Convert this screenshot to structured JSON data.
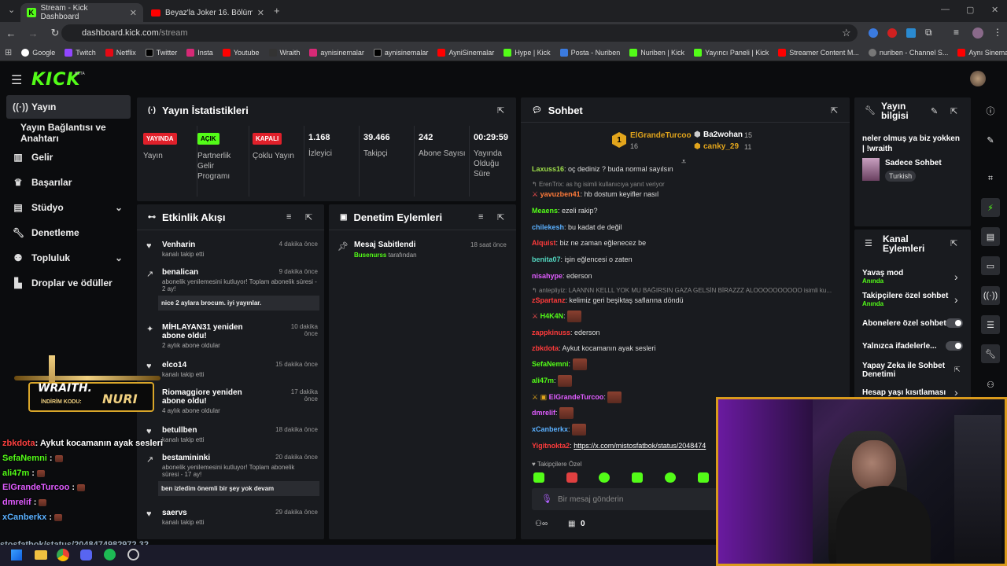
{
  "browser": {
    "tabs": [
      {
        "label": "Stream - Kick Dashboard",
        "icon": "kick-favicon"
      },
      {
        "label": "Beyaz'la Joker 16. Bölüm - YouT",
        "icon": "youtube-favicon"
      }
    ],
    "url_host": "dashboard.kick.com",
    "url_path": "/stream",
    "bookmarks": [
      "Google",
      "Twitch",
      "Netflix",
      "Twitter",
      "Insta",
      "Youtube",
      "Wraith",
      "aynisinemalar",
      "aynisinemalar",
      "AyniSinemalar",
      "Hype | Kick",
      "Posta - Nuriben",
      "Nuriben | Kick",
      "Yayıncı Paneli | Kick",
      "Streamer Content M...",
      "nuriben - Channel S...",
      "Aynı Sinemalar - Ça..."
    ]
  },
  "brand": {
    "logo": "KICK",
    "beta": "BETA",
    "accent": "#53fc18"
  },
  "sidebar": {
    "items": [
      {
        "label": "Yayın",
        "icon": "broadcast-icon"
      },
      {
        "label": "Yayın Bağlantısı ve Anahtarı",
        "icon": ""
      },
      {
        "label": "Gelir",
        "icon": "chart-icon"
      },
      {
        "label": "Başarılar",
        "icon": "trophy-icon"
      },
      {
        "label": "Stüdyo",
        "icon": "studio-icon"
      },
      {
        "label": "Denetleme",
        "icon": "wrench-icon"
      },
      {
        "label": "Topluluk",
        "icon": "community-icon"
      },
      {
        "label": "Droplar ve ödüller",
        "icon": "drops-icon"
      }
    ]
  },
  "stats": {
    "title": "Yayın İstatistikleri",
    "items": [
      {
        "badge": "YAYINDA",
        "label": "Yayın",
        "badge_color": "#e0202a"
      },
      {
        "badge": "AÇIK",
        "label": "Partnerlik Gelir Programı",
        "badge_color": "#53fc18"
      },
      {
        "badge": "KAPALI",
        "label": "Çoklu Yayın",
        "badge_color": "#e0202a"
      },
      {
        "value": "1.168",
        "label": "İzleyici"
      },
      {
        "value": "39.466",
        "label": "Takipçi"
      },
      {
        "value": "242",
        "label": "Abone Sayısı"
      },
      {
        "value": "00:29:59",
        "label": "Yayında Olduğu Süre"
      }
    ]
  },
  "activity": {
    "title": "Etkinlik Akışı",
    "events": [
      {
        "name": "Venharin",
        "sub": "kanalı takip etti",
        "time": "4 dakika önce"
      },
      {
        "name": "benalican",
        "sub": "abonelik yenilemesini kutluyor! Toplam abonelik süresi - 2 ay!",
        "time": "9 dakika önce",
        "msg": "nice 2 aylara brocum. iyi yayınlar."
      },
      {
        "name": "MİHLAYAN31 yeniden abone oldu!",
        "sub": "2 aylık abone oldular",
        "time": "10 dakika önce"
      },
      {
        "name": "elco14",
        "sub": "kanalı takip etti",
        "time": "15 dakika önce"
      },
      {
        "name": "Riomaggiore yeniden abone oldu!",
        "sub": "4 aylık abone oldular",
        "time": "17 dakika önce"
      },
      {
        "name": "betullben",
        "sub": "kanalı takip etti",
        "time": "18 dakika önce"
      },
      {
        "name": "bestamininki",
        "sub": "abonelik yenilemesini kutluyor! Toplam abonelik süresi - 17 ay!",
        "time": "20 dakika önce",
        "msg": "ben izledim önemli bir şey yok devam"
      },
      {
        "name": "saervs",
        "sub": "kanalı takip etti",
        "time": "29 dakika önce"
      }
    ]
  },
  "moderation": {
    "title": "Denetim Eylemleri",
    "item": {
      "name": "Mesaj Sabitlendi",
      "by": "Busenurss",
      "by_suffix": "tarafından",
      "time": "18 saat önce"
    }
  },
  "chat": {
    "title": "Sohbet",
    "top": [
      {
        "rank": "1",
        "name": "ElGrandeTurcoo",
        "count": "16"
      },
      {
        "name": "Ba2wohan",
        "count": "15"
      },
      {
        "name": "canky_29",
        "count": "11"
      }
    ],
    "lines": [
      {
        "user": "Laxuss16",
        "text": ": oç dediniz ? buda normal sayılsın",
        "color": "#9fe04a"
      },
      {
        "reply": "ErenTrix: as hg isimli kullanıcıya yanıt veriyor"
      },
      {
        "user": "yavuzben41",
        "text": ": hb dostum keyifler nasıl",
        "color": "#ff7a3a"
      },
      {
        "user": "Meaens",
        "text": ": ezeli rakip?",
        "color": "#53fc18"
      },
      {
        "user": "chilekesh",
        "text": ": bu kadat de değil",
        "color": "#5ab0ff"
      },
      {
        "user": "Alquist",
        "text": ": biz ne zaman eğlenecez be",
        "color": "#ff3b3b"
      },
      {
        "user": "benita07",
        "text": ": işin eğlencesi o zaten",
        "color": "#53d6c0"
      },
      {
        "user": "nisahype",
        "text": ": ederson",
        "color": "#e05cff"
      },
      {
        "reply": "antepliyiz: LAANNN KELLL YOK MU BAĞIRSIN GAZA GELSİN BİRAZZZ ALOOOOOOOOOO isimli ku..."
      },
      {
        "user": "zSpartanz",
        "text": ": kelimiz geri beşiktaş saflarına döndü",
        "color": "#ff3b3b"
      },
      {
        "user": "H4K4N",
        "text": ":",
        "color": "#53fc18",
        "emote": true
      },
      {
        "user": "zappkinuss",
        "text": ": ederson",
        "color": "#ff3b3b"
      },
      {
        "user": "zbkdota",
        "text": ": Aykut kocamanın ayak sesleri",
        "color": "#ff3b3b"
      },
      {
        "user": "SefaNemni",
        "text": ":",
        "color": "#53fc18",
        "emote": true
      },
      {
        "user": "ali47m",
        "text": ":",
        "color": "#53fc18",
        "emote": true
      },
      {
        "user": "ElGrandeTurcoo",
        "text": ":",
        "color": "#e05cff",
        "emote": true
      },
      {
        "user": "dmrelif",
        "text": ":",
        "color": "#e05cff",
        "emote": true
      },
      {
        "user": "xCanberkx",
        "text": ":",
        "color": "#5ab0ff",
        "emote": true
      },
      {
        "user": "Yigitnokta2",
        "text": ": ",
        "link": "https://x.com/mistosfatbok/status/2048474",
        "color": "#ff3b3b"
      }
    ],
    "followers_only": "Takipçilere Özel",
    "input_placeholder": "Bir mesaj gönderin",
    "footer_count": "0"
  },
  "stream_info": {
    "title": "Yayın bilgisi",
    "stream_title": "neler olmuş ya biz yokken | !wraith",
    "category": "Sadece Sohbet",
    "language": "Turkish"
  },
  "channel_actions": {
    "title": "Kanal Eylemleri",
    "items": [
      {
        "label": "Yavaş mod",
        "sub": "Anında",
        "type": "chevron"
      },
      {
        "label": "Takipçilere özel sohbet",
        "sub": "Anında",
        "type": "chevron"
      },
      {
        "label": "Abonelere özel sohbet",
        "type": "toggle"
      },
      {
        "label": "Yalnızca ifadelerle...",
        "type": "toggle"
      },
      {
        "label": "Yapay Zeka ile Sohbet Denetimi",
        "type": "link"
      },
      {
        "label": "Hesap yaşı kısıtlaması",
        "type": "chevron"
      }
    ]
  },
  "overlay": {
    "sponsor": "WRAITH.",
    "promo_label": "İNDİRİM KODU:",
    "promo_code": "NURI",
    "lines": [
      {
        "user": "zbkdota",
        "text": ": Aykut kocamanın ayak sesleri",
        "color": "#ff4040"
      },
      {
        "user": "SefaNemni",
        "text": " :",
        "color": "#53fc18"
      },
      {
        "user": "ali47m",
        "text": " :",
        "color": "#53fc18"
      },
      {
        "user": "ElGrandeTurcoo",
        "text": " :",
        "color": "#e05cff"
      },
      {
        "user": "dmrelif",
        "text": " :",
        "color": "#e05cff"
      },
      {
        "user": "xCanberkx",
        "text": " :",
        "color": "#5ab0ff"
      }
    ],
    "link": "stosfatbok/status/2048474982972 32"
  }
}
